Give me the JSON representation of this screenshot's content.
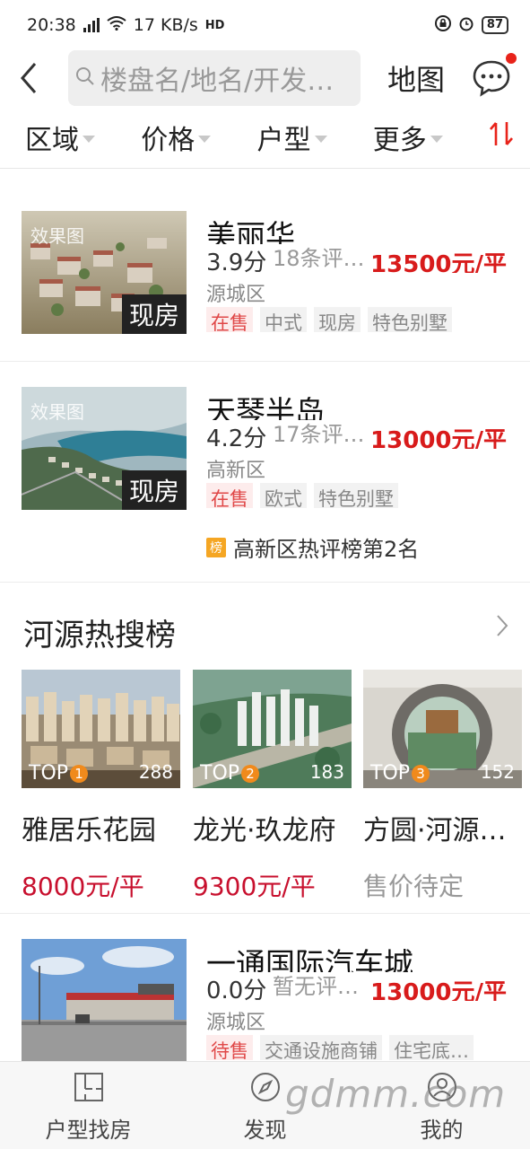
{
  "status_bar": {
    "time": "20:38",
    "network": "4G",
    "speed": "17 KB/s",
    "hd": "HD",
    "battery": "87"
  },
  "header": {
    "search_placeholder": "楼盘名/地名/开发…",
    "map_label": "地图",
    "icons": [
      "back-icon",
      "search-icon",
      "message-icon"
    ]
  },
  "filters": {
    "items": [
      "区域",
      "价格",
      "户型",
      "更多"
    ],
    "sort_icon": "sort-icon"
  },
  "listings": [
    {
      "name": "美丽华",
      "score": "3.9分",
      "reviews": "18条评…",
      "price": "13500元/平",
      "district": "源城区",
      "badge": "现房",
      "effect_label": "效果图",
      "tags": [
        "在售",
        "中式",
        "现房",
        "特色别墅"
      ]
    },
    {
      "name": "天琴半岛",
      "score": "4.2分",
      "reviews": "17条评…",
      "price": "13000元/平",
      "district": "高新区",
      "badge": "现房",
      "effect_label": "效果图",
      "tags": [
        "在售",
        "欧式",
        "特色别墅"
      ],
      "rank_icon": "榜",
      "rank_text": "高新区热评榜第2名"
    },
    {
      "name": "一通国际汽车城",
      "score": "0.0分",
      "reviews": "暂无评…",
      "price": "13000元/平",
      "district": "源城区",
      "tags": [
        "待售",
        "交通设施商铺",
        "住宅底…"
      ]
    }
  ],
  "hot": {
    "title": "河源热搜榜",
    "items": [
      {
        "top": "TOP",
        "rank": "1",
        "count": "288",
        "name": "雅居乐花园",
        "price": "8000元/平"
      },
      {
        "top": "TOP",
        "rank": "2",
        "count": "183",
        "name": "龙光·玖龙府",
        "price": "9300元/平"
      },
      {
        "top": "TOP",
        "rank": "3",
        "count": "152",
        "name": "方圆·河源…",
        "price": "售价待定"
      }
    ]
  },
  "bottom_nav": {
    "items": [
      "户型找房",
      "发现",
      "我的"
    ]
  },
  "watermark": "gdmm.com"
}
